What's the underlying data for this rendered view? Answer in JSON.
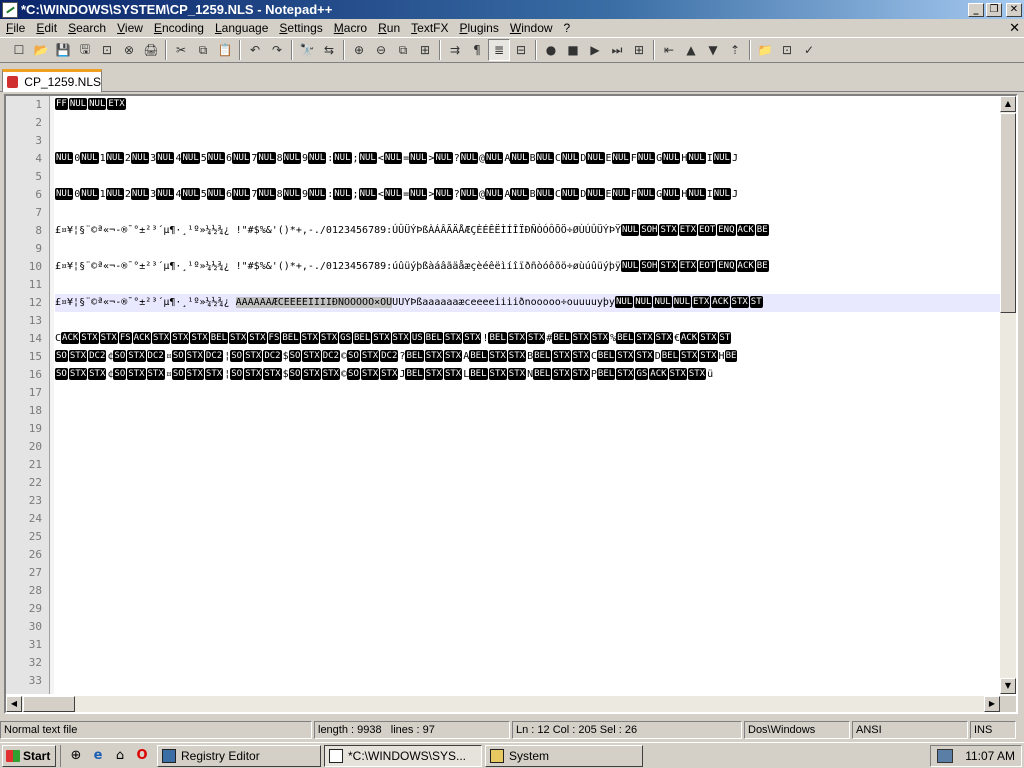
{
  "window": {
    "title": "*C:\\WINDOWS\\SYSTEM\\CP_1259.NLS - Notepad++",
    "min_glyph": "_",
    "max_glyph": "❐",
    "close_glyph": "✕"
  },
  "menu": [
    "File",
    "Edit",
    "Search",
    "View",
    "Encoding",
    "Language",
    "Settings",
    "Macro",
    "Run",
    "TextFX",
    "Plugins",
    "Window",
    "?"
  ],
  "menu_close_glyph": "✕",
  "toolbar_glyphs": [
    "☐",
    "📂",
    "💾",
    "🖫",
    "⊡",
    "⊗",
    "🖨",
    "✂",
    "⧉",
    "📋",
    "↶",
    "↷",
    "🔭",
    "⇆",
    "⊕",
    "⊖",
    "⧉",
    "⊞",
    "⇉",
    "¶",
    "≣",
    "⊟",
    "●",
    "■",
    "▶",
    "⏭",
    "⊞",
    "⇤",
    "▲",
    "▼",
    "⇡",
    "📁",
    "⊡",
    "✓"
  ],
  "tab": {
    "label": "CP_1259.NLS"
  },
  "editor": {
    "line_numbers": [
      "1",
      "2",
      "3",
      "4",
      "5",
      "6",
      "7",
      "8",
      "9",
      "10",
      "11",
      "12",
      "13",
      "14",
      "15",
      "16",
      "17",
      "18",
      "19",
      "20",
      "21",
      "22",
      "23",
      "24",
      "25",
      "26",
      "27",
      "28",
      "29",
      "30",
      "31",
      "32",
      "33"
    ],
    "current_line": 12,
    "lines": [
      {
        "n": 1,
        "segs": [
          [
            "c",
            "FF"
          ],
          [
            "c",
            "NUL"
          ],
          [
            "c",
            "NUL"
          ],
          [
            "c",
            "ETX"
          ]
        ]
      },
      {
        "n": 4,
        "segs": [
          [
            "c",
            "NUL"
          ],
          [
            "t",
            "0"
          ],
          [
            "c",
            "NUL"
          ],
          [
            "t",
            "1"
          ],
          [
            "c",
            "NUL"
          ],
          [
            "t",
            "2"
          ],
          [
            "c",
            "NUL"
          ],
          [
            "t",
            "3"
          ],
          [
            "c",
            "NUL"
          ],
          [
            "t",
            "4"
          ],
          [
            "c",
            "NUL"
          ],
          [
            "t",
            "5"
          ],
          [
            "c",
            "NUL"
          ],
          [
            "t",
            "6"
          ],
          [
            "c",
            "NUL"
          ],
          [
            "t",
            "7"
          ],
          [
            "c",
            "NUL"
          ],
          [
            "t",
            "8"
          ],
          [
            "c",
            "NUL"
          ],
          [
            "t",
            "9"
          ],
          [
            "c",
            "NUL"
          ],
          [
            "t",
            ":"
          ],
          [
            "c",
            "NUL"
          ],
          [
            "t",
            ";"
          ],
          [
            "c",
            "NUL"
          ],
          [
            "t",
            "<"
          ],
          [
            "c",
            "NUL"
          ],
          [
            "t",
            "="
          ],
          [
            "c",
            "NUL"
          ],
          [
            "t",
            ">"
          ],
          [
            "c",
            "NUL"
          ],
          [
            "t",
            "?"
          ],
          [
            "c",
            "NUL"
          ],
          [
            "t",
            "@"
          ],
          [
            "c",
            "NUL"
          ],
          [
            "t",
            "A"
          ],
          [
            "c",
            "NUL"
          ],
          [
            "t",
            "B"
          ],
          [
            "c",
            "NUL"
          ],
          [
            "t",
            "C"
          ],
          [
            "c",
            "NUL"
          ],
          [
            "t",
            "D"
          ],
          [
            "c",
            "NUL"
          ],
          [
            "t",
            "E"
          ],
          [
            "c",
            "NUL"
          ],
          [
            "t",
            "F"
          ],
          [
            "c",
            "NUL"
          ],
          [
            "t",
            "G"
          ],
          [
            "c",
            "NUL"
          ],
          [
            "t",
            "H"
          ],
          [
            "c",
            "NUL"
          ],
          [
            "t",
            "I"
          ],
          [
            "c",
            "NUL"
          ],
          [
            "t",
            "J"
          ]
        ]
      },
      {
        "n": 6,
        "segs": [
          [
            "c",
            "NUL"
          ],
          [
            "t",
            "0"
          ],
          [
            "c",
            "NUL"
          ],
          [
            "t",
            "1"
          ],
          [
            "c",
            "NUL"
          ],
          [
            "t",
            "2"
          ],
          [
            "c",
            "NUL"
          ],
          [
            "t",
            "3"
          ],
          [
            "c",
            "NUL"
          ],
          [
            "t",
            "4"
          ],
          [
            "c",
            "NUL"
          ],
          [
            "t",
            "5"
          ],
          [
            "c",
            "NUL"
          ],
          [
            "t",
            "6"
          ],
          [
            "c",
            "NUL"
          ],
          [
            "t",
            "7"
          ],
          [
            "c",
            "NUL"
          ],
          [
            "t",
            "8"
          ],
          [
            "c",
            "NUL"
          ],
          [
            "t",
            "9"
          ],
          [
            "c",
            "NUL"
          ],
          [
            "t",
            ":"
          ],
          [
            "c",
            "NUL"
          ],
          [
            "t",
            ";"
          ],
          [
            "c",
            "NUL"
          ],
          [
            "t",
            "<"
          ],
          [
            "c",
            "NUL"
          ],
          [
            "t",
            "="
          ],
          [
            "c",
            "NUL"
          ],
          [
            "t",
            ">"
          ],
          [
            "c",
            "NUL"
          ],
          [
            "t",
            "?"
          ],
          [
            "c",
            "NUL"
          ],
          [
            "t",
            "@"
          ],
          [
            "c",
            "NUL"
          ],
          [
            "t",
            "A"
          ],
          [
            "c",
            "NUL"
          ],
          [
            "t",
            "B"
          ],
          [
            "c",
            "NUL"
          ],
          [
            "t",
            "C"
          ],
          [
            "c",
            "NUL"
          ],
          [
            "t",
            "D"
          ],
          [
            "c",
            "NUL"
          ],
          [
            "t",
            "E"
          ],
          [
            "c",
            "NUL"
          ],
          [
            "t",
            "F"
          ],
          [
            "c",
            "NUL"
          ],
          [
            "t",
            "G"
          ],
          [
            "c",
            "NUL"
          ],
          [
            "t",
            "H"
          ],
          [
            "c",
            "NUL"
          ],
          [
            "t",
            "I"
          ],
          [
            "c",
            "NUL"
          ],
          [
            "t",
            "J"
          ]
        ]
      },
      {
        "n": 8,
        "segs": [
          [
            "t",
            "£¤¥¦§¨©ª«¬-®¯°±²³´µ¶·¸¹º»¼½¾¿ !\"#$%&'()*+,-./0123456789:ÚÛÜÝÞßÀÁÂÃÄÅÆÇÈÉÊËÌÍÎÏÐÑÒÓÔÕÖ÷ØÙÚÛÜÝÞŸ"
          ],
          [
            "c",
            "NUL"
          ],
          [
            "c",
            "SOH"
          ],
          [
            "c",
            "STX"
          ],
          [
            "c",
            "ETX"
          ],
          [
            "c",
            "EOT"
          ],
          [
            "c",
            "ENQ"
          ],
          [
            "c",
            "ACK"
          ],
          [
            "c",
            "BE"
          ]
        ]
      },
      {
        "n": 10,
        "segs": [
          [
            "t",
            "£¤¥¦§¨©ª«¬-®¯°±²³´µ¶·¸¹º»¼½¾¿ !\"#$%&'()*+,-./0123456789:úûüýþßàáâãäåæçèéêëìíîïðñòóôõö÷øùúûüýþÿ"
          ],
          [
            "c",
            "NUL"
          ],
          [
            "c",
            "SOH"
          ],
          [
            "c",
            "STX"
          ],
          [
            "c",
            "ETX"
          ],
          [
            "c",
            "EOT"
          ],
          [
            "c",
            "ENQ"
          ],
          [
            "c",
            "ACK"
          ],
          [
            "c",
            "BE"
          ]
        ]
      },
      {
        "n": 12,
        "segs": [
          [
            "t",
            "£¤¥¦§¨©ª«¬-®¯°±²³´µ¶·¸¹º»¼½¾¿ "
          ],
          [
            "s",
            "AAAAAAÆCEEEEIIIIÐNOOOOO×OU"
          ],
          [
            "t",
            "UUYÞßaaaaaaæceeeeiiiiðnooooo÷ouuuuyþy"
          ],
          [
            "c",
            "NUL"
          ],
          [
            "c",
            "NUL"
          ],
          [
            "c",
            "NUL"
          ],
          [
            "c",
            "NUL"
          ],
          [
            "c",
            "ETX"
          ],
          [
            "c",
            "ACK"
          ],
          [
            "c",
            "STX"
          ],
          [
            "c",
            "ST"
          ]
        ]
      },
      {
        "n": 14,
        "segs": [
          [
            "t",
            "C"
          ],
          [
            "c",
            "ACK"
          ],
          [
            "c",
            "STX"
          ],
          [
            "c",
            "STX"
          ],
          [
            "c",
            "FS"
          ],
          [
            "c",
            "ACK"
          ],
          [
            "c",
            "STX"
          ],
          [
            "c",
            "STX"
          ],
          [
            "c",
            "STX"
          ],
          [
            "c",
            "BEL"
          ],
          [
            "c",
            "STX"
          ],
          [
            "c",
            "STX"
          ],
          [
            "c",
            "FS"
          ],
          [
            "c",
            "BEL"
          ],
          [
            "c",
            "STX"
          ],
          [
            "c",
            "STX"
          ],
          [
            "c",
            "GS"
          ],
          [
            "c",
            "BEL"
          ],
          [
            "c",
            "STX"
          ],
          [
            "c",
            "STX"
          ],
          [
            "c",
            "US"
          ],
          [
            "c",
            "BEL"
          ],
          [
            "c",
            "STX"
          ],
          [
            "c",
            "STX"
          ],
          [
            "t",
            "!"
          ],
          [
            "c",
            "BEL"
          ],
          [
            "c",
            "STX"
          ],
          [
            "c",
            "STX"
          ],
          [
            "t",
            "#"
          ],
          [
            "c",
            "BEL"
          ],
          [
            "c",
            "STX"
          ],
          [
            "c",
            "STX"
          ],
          [
            "t",
            "%"
          ],
          [
            "c",
            "BEL"
          ],
          [
            "c",
            "STX"
          ],
          [
            "c",
            "STX"
          ],
          [
            "t",
            "€"
          ],
          [
            "c",
            "ACK"
          ],
          [
            "c",
            "STX"
          ],
          [
            "c",
            "ST"
          ]
        ]
      },
      {
        "n": 15,
        "segs": [
          [
            "c",
            "SO"
          ],
          [
            "c",
            "STX"
          ],
          [
            "c",
            "DC2"
          ],
          [
            "t",
            "¢"
          ],
          [
            "c",
            "SO"
          ],
          [
            "c",
            "STX"
          ],
          [
            "c",
            "DC2"
          ],
          [
            "t",
            "¤"
          ],
          [
            "c",
            "SO"
          ],
          [
            "c",
            "STX"
          ],
          [
            "c",
            "DC2"
          ],
          [
            "t",
            "¦"
          ],
          [
            "c",
            "SO"
          ],
          [
            "c",
            "STX"
          ],
          [
            "c",
            "DC2"
          ],
          [
            "t",
            "$"
          ],
          [
            "c",
            "SO"
          ],
          [
            "c",
            "STX"
          ],
          [
            "c",
            "DC2"
          ],
          [
            "t",
            "©"
          ],
          [
            "c",
            "SO"
          ],
          [
            "c",
            "STX"
          ],
          [
            "c",
            "DC2"
          ],
          [
            "t",
            "?"
          ],
          [
            "c",
            "BEL"
          ],
          [
            "c",
            "STX"
          ],
          [
            "c",
            "STX"
          ],
          [
            "t",
            "A"
          ],
          [
            "c",
            "BEL"
          ],
          [
            "c",
            "STX"
          ],
          [
            "c",
            "STX"
          ],
          [
            "t",
            "B"
          ],
          [
            "c",
            "BEL"
          ],
          [
            "c",
            "STX"
          ],
          [
            "c",
            "STX"
          ],
          [
            "t",
            "C"
          ],
          [
            "c",
            "BEL"
          ],
          [
            "c",
            "STX"
          ],
          [
            "c",
            "STX"
          ],
          [
            "t",
            "D"
          ],
          [
            "c",
            "BEL"
          ],
          [
            "c",
            "STX"
          ],
          [
            "c",
            "STX"
          ],
          [
            "t",
            "H"
          ],
          [
            "c",
            "BE"
          ]
        ]
      },
      {
        "n": 16,
        "segs": [
          [
            "c",
            "SO"
          ],
          [
            "c",
            "STX"
          ],
          [
            "c",
            "STX"
          ],
          [
            "t",
            "¢"
          ],
          [
            "c",
            "SO"
          ],
          [
            "c",
            "STX"
          ],
          [
            "c",
            "STX"
          ],
          [
            "t",
            "¤"
          ],
          [
            "c",
            "SO"
          ],
          [
            "c",
            "STX"
          ],
          [
            "c",
            "STX"
          ],
          [
            "t",
            "¦"
          ],
          [
            "c",
            "SO"
          ],
          [
            "c",
            "STX"
          ],
          [
            "c",
            "STX"
          ],
          [
            "t",
            "$"
          ],
          [
            "c",
            "SO"
          ],
          [
            "c",
            "STX"
          ],
          [
            "c",
            "STX"
          ],
          [
            "t",
            "©"
          ],
          [
            "c",
            "SO"
          ],
          [
            "c",
            "STX"
          ],
          [
            "c",
            "STX"
          ],
          [
            "t",
            "J"
          ],
          [
            "c",
            "BEL"
          ],
          [
            "c",
            "STX"
          ],
          [
            "c",
            "STX"
          ],
          [
            "t",
            "L"
          ],
          [
            "c",
            "BEL"
          ],
          [
            "c",
            "STX"
          ],
          [
            "c",
            "STX"
          ],
          [
            "t",
            "N"
          ],
          [
            "c",
            "BEL"
          ],
          [
            "c",
            "STX"
          ],
          [
            "c",
            "STX"
          ],
          [
            "t",
            "P"
          ],
          [
            "c",
            "BEL"
          ],
          [
            "c",
            "STX"
          ],
          [
            "c",
            "GS"
          ],
          [
            "c",
            "ACK"
          ],
          [
            "c",
            "STX"
          ],
          [
            "c",
            "STX"
          ],
          [
            "t",
            "ü"
          ]
        ]
      }
    ]
  },
  "scroll_glyphs": {
    "up": "▲",
    "down": "▼",
    "left": "◀",
    "right": "▶"
  },
  "status": {
    "file_type": "Normal text file",
    "length": "length : 9938",
    "lines": "lines : 97",
    "position": "Ln : 12    Col : 205    Sel : 26",
    "eol": "Dos\\Windows",
    "encoding": "ANSI",
    "mode": "INS"
  },
  "taskbar": {
    "start_label": "Start",
    "quicklaunch_glyphs": [
      "⊕",
      "e",
      "⌂",
      "O"
    ],
    "tasks": [
      {
        "label": "Registry Editor",
        "active": false
      },
      {
        "label": "*C:\\WINDOWS\\SYS...",
        "active": true
      },
      {
        "label": "System",
        "active": false
      }
    ],
    "clock": "11:07 AM"
  }
}
